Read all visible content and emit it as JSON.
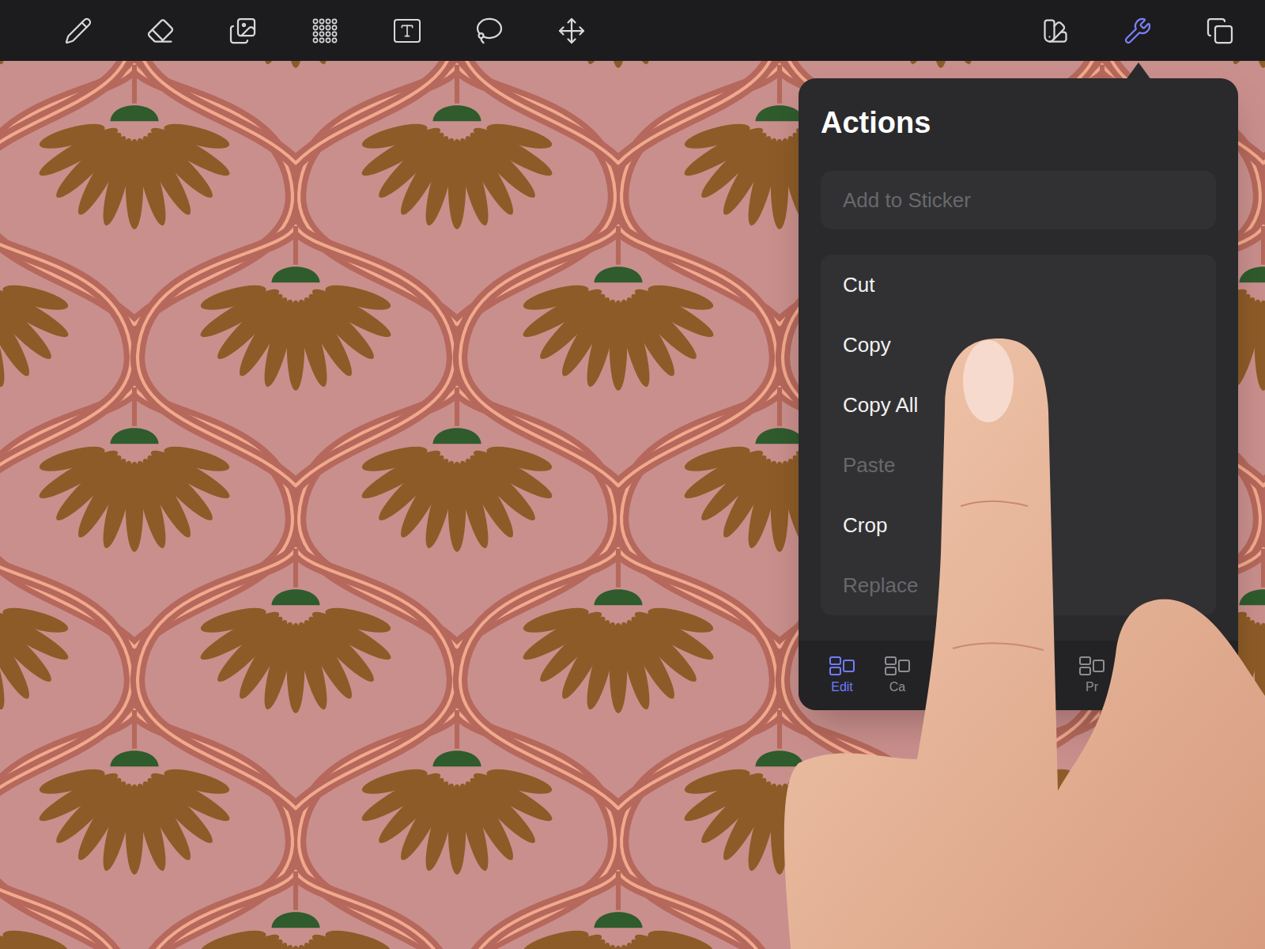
{
  "toolbar": {
    "left": [
      {
        "selected": false
      },
      {
        "selected": false
      },
      {
        "selected": false
      },
      {
        "selected": false
      },
      {
        "selected": false
      },
      {
        "selected": false
      },
      {
        "selected": false
      }
    ],
    "right": [
      {
        "selected": false
      },
      {
        "selected": true
      },
      {
        "selected": false
      }
    ]
  },
  "popover": {
    "title": "Actions",
    "sticker_button": {
      "label": "Add to Sticker",
      "disabled": true
    },
    "items": [
      {
        "label": "Cut",
        "disabled": false
      },
      {
        "label": "Copy",
        "disabled": false
      },
      {
        "label": "Copy All",
        "disabled": false
      },
      {
        "label": "Paste",
        "disabled": true
      },
      {
        "label": "Crop",
        "disabled": false
      },
      {
        "label": "Replace",
        "disabled": true
      }
    ],
    "tabs": [
      {
        "label": "Edit",
        "selected": true
      },
      {
        "label": "Ca",
        "selected": false
      },
      {
        "label": "Pr",
        "selected": false
      }
    ]
  }
}
